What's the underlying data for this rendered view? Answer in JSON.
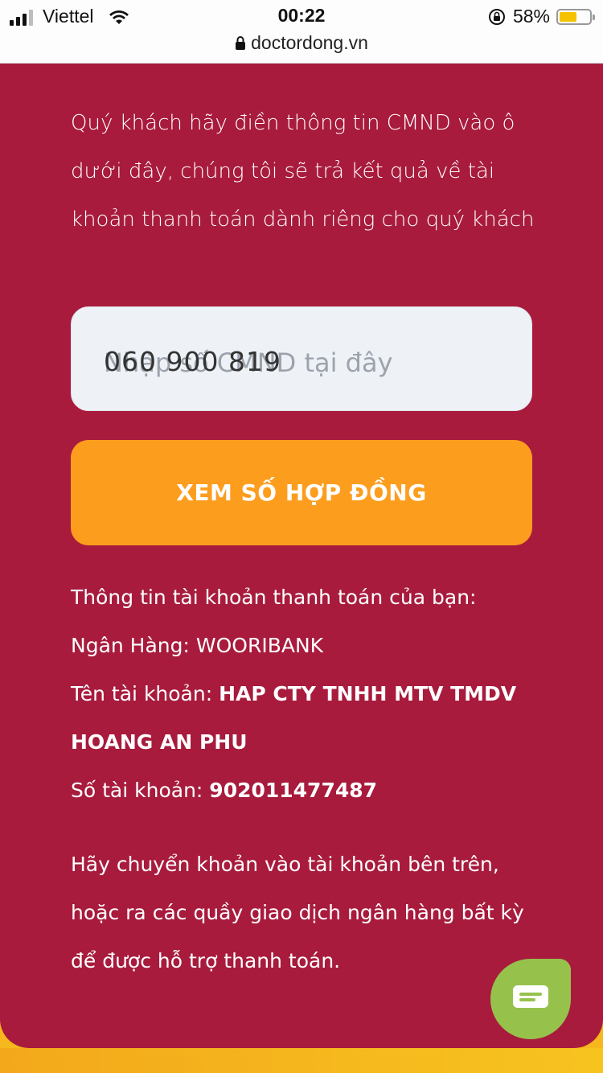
{
  "status_bar": {
    "carrier": "Viettel",
    "time": "00:22",
    "url": "doctordong.vn",
    "battery_percent": "58%",
    "battery_level": 0.58
  },
  "intro_text": "Quý khách hãy điền thông tin CMND vào ô dưới đây, chúng tôi sẽ trả kết quả về tài khoản thanh toán dành riêng cho quý khách",
  "id_field": {
    "value": "060 900 819",
    "placeholder": "Nhập số CMND tại đây"
  },
  "cta_label": "XEM SỐ HỢP ĐỒNG",
  "account_info": {
    "heading": "Thông tin tài khoản thanh toán của bạn:",
    "bank_label": "Ngân Hàng:",
    "bank_value": "WOORIBANK",
    "name_label": "Tên tài khoản:",
    "name_value": "HAP CTY TNHH MTV TMDV HOANG AN PHU",
    "number_label": "Số tài khoản:",
    "number_value": "902011477487"
  },
  "transfer_text": "Hãy chuyển khoản vào tài khoản bên trên, hoặc ra các quầy giao dịch ngân hàng bất kỳ để được hỗ trợ thanh toán.",
  "icons": {
    "chat": "chat-bubble-icon",
    "lock": "lock-icon",
    "wifi": "wifi-icon",
    "orientation_lock": "orientation-lock-icon"
  },
  "colors": {
    "panel": "#a81b3d",
    "cta": "#fd9d1e",
    "chat": "#96c24c"
  }
}
